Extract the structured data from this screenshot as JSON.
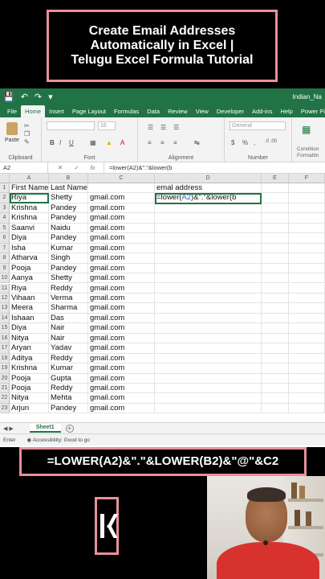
{
  "title": {
    "line1": "Create Email Addresses",
    "line2": "Automatically in Excel |",
    "line3": "Telugu Excel Formula Tutorial"
  },
  "excel": {
    "filename": "Indian_Na",
    "tabs": [
      "File",
      "Home",
      "Insert",
      "Page Layout",
      "Formulas",
      "Data",
      "Review",
      "View",
      "Developer",
      "Add-ins",
      "Help",
      "Power Pivot"
    ],
    "active_tab": "Home",
    "ribbon": {
      "paste": "Paste",
      "clipboard": "Clipboard",
      "font_group": "Font",
      "font_size": "16",
      "alignment_group": "Alignment",
      "number_format": "General",
      "number_group": "Number",
      "conditional": "Condition\nFormattin"
    },
    "name_box": "A2",
    "fx": "fx",
    "formula_text": "=lower(A2)&\".\"&lower(b",
    "columns": [
      "A",
      "B",
      "C",
      "D",
      "E",
      "F"
    ],
    "header_row": {
      "a": "First Name",
      "b": "Last Name",
      "d": "emal address"
    },
    "edit_cell": {
      "pre": "=lower(",
      "ref": "A2",
      "post": ")&\".\"&lower(b"
    },
    "rows": [
      {
        "n": "2",
        "first": "Riya",
        "last": "Shetty",
        "domain": "gmail.com"
      },
      {
        "n": "3",
        "first": "Krishna",
        "last": "Pandey",
        "domain": "gmail.com"
      },
      {
        "n": "4",
        "first": "Krishna",
        "last": "Pandey",
        "domain": "gmail.com"
      },
      {
        "n": "5",
        "first": "Saanvi",
        "last": "Naidu",
        "domain": "gmail.com"
      },
      {
        "n": "6",
        "first": "Diya",
        "last": "Pandey",
        "domain": "gmail.com"
      },
      {
        "n": "7",
        "first": "Isha",
        "last": "Kumar",
        "domain": "gmail.com"
      },
      {
        "n": "8",
        "first": "Atharva",
        "last": "Singh",
        "domain": "gmail.com"
      },
      {
        "n": "9",
        "first": "Pooja",
        "last": "Pandey",
        "domain": "gmail.com"
      },
      {
        "n": "10",
        "first": "Aanya",
        "last": "Shetty",
        "domain": "gmail.com"
      },
      {
        "n": "11",
        "first": "Riya",
        "last": "Reddy",
        "domain": "gmail.com"
      },
      {
        "n": "12",
        "first": "Vihaan",
        "last": "Verma",
        "domain": "gmail.com"
      },
      {
        "n": "13",
        "first": "Meera",
        "last": "Sharma",
        "domain": "gmail.com"
      },
      {
        "n": "14",
        "first": "Ishaan",
        "last": "Das",
        "domain": "gmail.com"
      },
      {
        "n": "15",
        "first": "Diya",
        "last": "Nair",
        "domain": "gmail.com"
      },
      {
        "n": "16",
        "first": "Nitya",
        "last": "Nair",
        "domain": "gmail.com"
      },
      {
        "n": "17",
        "first": "Aryan",
        "last": "Yadav",
        "domain": "gmail.com"
      },
      {
        "n": "18",
        "first": "Aditya",
        "last": "Reddy",
        "domain": "gmail.com"
      },
      {
        "n": "19",
        "first": "Krishna",
        "last": "Kumar",
        "domain": "gmail.com"
      },
      {
        "n": "20",
        "first": "Pooja",
        "last": "Gupta",
        "domain": "gmail.com"
      },
      {
        "n": "21",
        "first": "Pooja",
        "last": "Reddy",
        "domain": "gmail.com"
      },
      {
        "n": "22",
        "first": "Nitya",
        "last": "Mehta",
        "domain": "gmail.com"
      },
      {
        "n": "23",
        "first": "Arjun",
        "last": "Pandey",
        "domain": "gmail.com"
      }
    ],
    "sheet_tab": "Sheet1",
    "status_mode": "Enter",
    "accessibility": "Accessibility: Good to go"
  },
  "formula_banner": "=LOWER(A2)&\".\"&LOWER(B2)&\"@\"&C2",
  "colors": {
    "excel_green": "#217346",
    "banner_border": "#e8909a",
    "ref_blue": "#2f5fd0"
  }
}
